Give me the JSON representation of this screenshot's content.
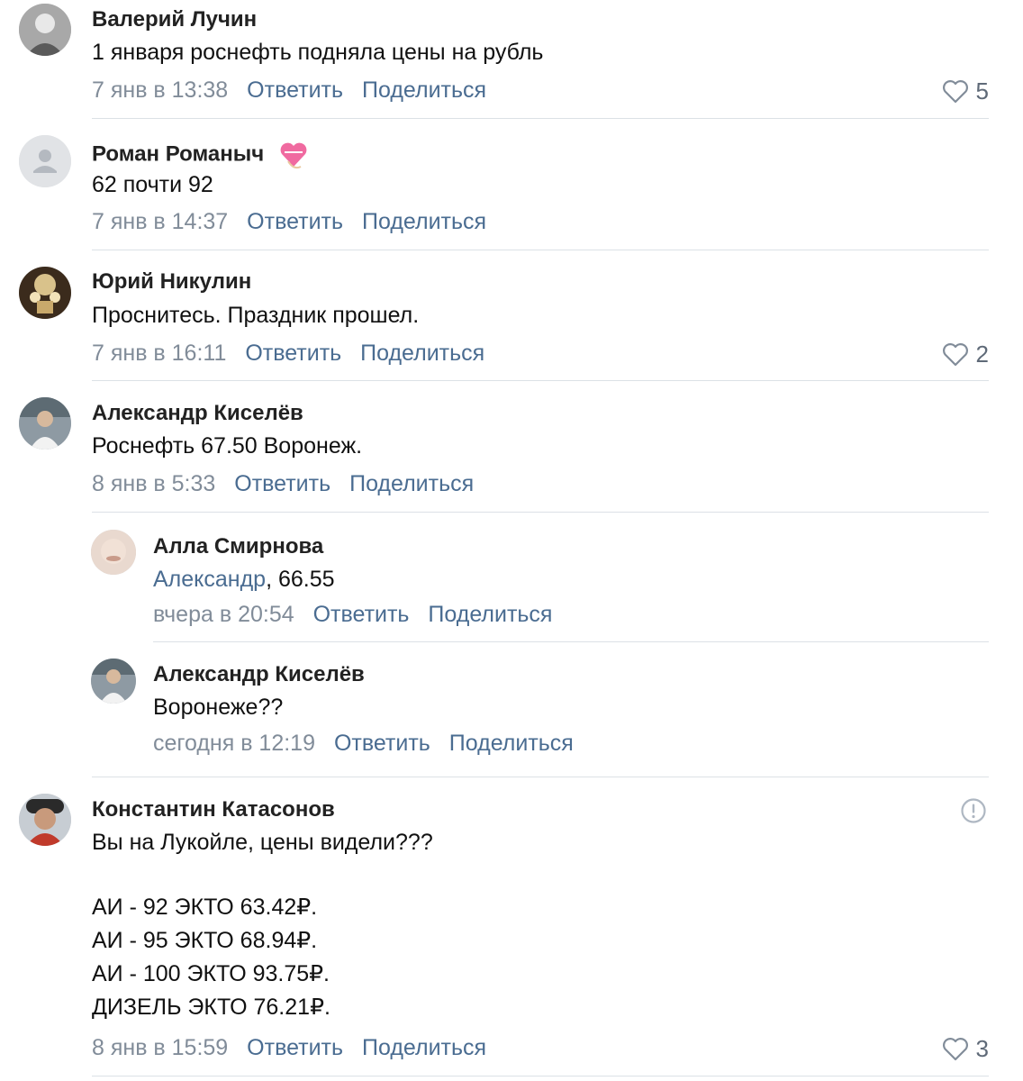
{
  "comments": [
    {
      "author": "Валерий Лучин",
      "text": "1 января роснефть подняла цены на рубль",
      "date": "7 янв в 13:38",
      "reply": "Ответить",
      "share": "Поделиться",
      "likes": "5"
    },
    {
      "author": "Роман Романыч",
      "text": "62 почти 92",
      "date": "7 янв в 14:37",
      "reply": "Ответить",
      "share": "Поделиться"
    },
    {
      "author": "Юрий Никулин",
      "text": "Проснитесь. Праздник прошел.",
      "date": "7 янв в 16:11",
      "reply": "Ответить",
      "share": "Поделиться",
      "likes": "2"
    },
    {
      "author": "Александр Киселёв",
      "text": "Роснефть 67.50 Воронеж.",
      "date": "8 янв в 5:33",
      "reply": "Ответить",
      "share": "Поделиться"
    },
    {
      "author": "Алла Смирнова",
      "mention": "Александр",
      "text": ", 66.55",
      "date": "вчера в 20:54",
      "reply": "Ответить",
      "share": "Поделиться"
    },
    {
      "author": "Александр Киселёв",
      "text": "Воронеже??",
      "date": "сегодня в 12:19",
      "reply": "Ответить",
      "share": "Поделиться"
    },
    {
      "author": "Константин Катасонов",
      "text_lines": [
        "Вы на Лукойле, цены видели???",
        "",
        "АИ - 92 ЭКТО 63.42₽.",
        "АИ - 95 ЭКТО 68.94₽.",
        "АИ - 100 ЭКТО 93.75₽.",
        "ДИЗЕЛЬ ЭКТО 76.21₽."
      ],
      "date": "8 янв в 15:59",
      "reply": "Ответить",
      "share": "Поделиться",
      "likes": "3"
    }
  ],
  "icons": {
    "like": "heart-outline-icon",
    "report": "exclamation-circle-icon",
    "author_badge": "heart-gift-icon"
  },
  "colors": {
    "link": "#4a6c91",
    "date": "#818c99",
    "divider": "#dce1e6"
  }
}
